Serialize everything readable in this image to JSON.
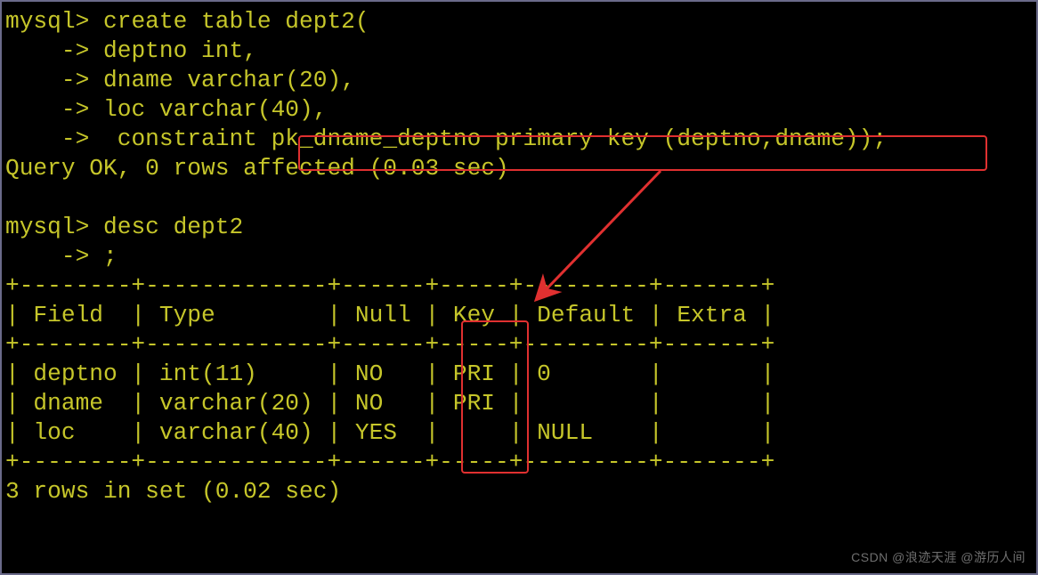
{
  "prompt_text": "mysql>",
  "cont_text": "    ->",
  "cmd_create": {
    "l1": " create table dept2(",
    "l2": " deptno int,",
    "l3": " dname varchar(20),",
    "l4": " loc varchar(40),",
    "l5": "  constraint pk_dname_deptno primary key (deptno,dname));"
  },
  "result_create": "Query OK, 0 rows affected (0.03 sec)",
  "cmd_desc": {
    "l1": " desc dept2",
    "l2": " ;"
  },
  "table": {
    "rule_top": "+--------+-------------+------+-----+---------+-------+",
    "header": "| Field  | Type        | Null | Key | Default | Extra |",
    "rule_mid": "+--------+-------------+------+-----+---------+-------+",
    "rows": [
      "| deptno | int(11)     | NO   | PRI | 0       |       |",
      "| dname  | varchar(20) | NO   | PRI |         |       |",
      "| loc    | varchar(40) | YES  |     | NULL    |       |"
    ],
    "rule_bot": "+--------+-------------+------+-----+---------+-------+"
  },
  "result_desc": "3 rows in set (0.02 sec)",
  "chart_data": {
    "type": "table",
    "title": "desc dept2",
    "columns": [
      "Field",
      "Type",
      "Null",
      "Key",
      "Default",
      "Extra"
    ],
    "rows": [
      {
        "Field": "deptno",
        "Type": "int(11)",
        "Null": "NO",
        "Key": "PRI",
        "Default": "0",
        "Extra": ""
      },
      {
        "Field": "dname",
        "Type": "varchar(20)",
        "Null": "NO",
        "Key": "PRI",
        "Default": "",
        "Extra": ""
      },
      {
        "Field": "loc",
        "Type": "varchar(40)",
        "Null": "YES",
        "Key": "",
        "Default": "NULL",
        "Extra": ""
      }
    ]
  },
  "annotations": {
    "highlighted_constraint": "pk_dname_deptno primary key (deptno,dname))",
    "highlighted_column": "Key",
    "arrow_from": "constraint clause",
    "arrow_to": "Key column"
  },
  "watermark": "CSDN @浪迹天涯 @游历人间"
}
